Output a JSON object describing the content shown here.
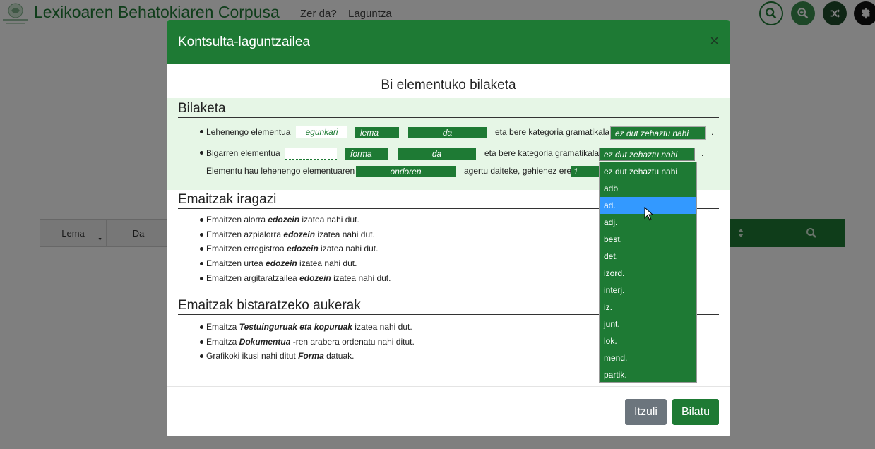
{
  "app": {
    "title": "Lexikoaren Behatokiaren Corpusa",
    "nav": [
      "Zer da?",
      "Laguntza"
    ],
    "accent_color": "#1e7a34",
    "buttons": [
      "search-icon",
      "zoom-icon",
      "shuffle-icon",
      "signpost-icon"
    ]
  },
  "background_table": {
    "cells": [
      "Lema",
      "Da"
    ],
    "right_icons": [
      "sort-icon",
      "search-icon"
    ]
  },
  "modal": {
    "title": "Kontsulta-laguntzailea",
    "close_label": "×",
    "subtitle": "Bi elementuko bilaketa",
    "search": {
      "heading": "Bilaketa",
      "first": {
        "label": "Lehenengo elementua",
        "input_placeholder": "egunkari",
        "type": "lema",
        "condition": "da",
        "category_text": "eta bere kategoria gramatikala",
        "category_value": "ez dut zehaztu nahi",
        "end": "."
      },
      "second": {
        "label": "Bigarren elementua",
        "input_value": "",
        "type": "forma",
        "condition": "da",
        "category_text": "eta bere kategoria gramatikala",
        "category_value": "ez dut zehaztu nahi",
        "end": "."
      },
      "relation": {
        "label": "Elementu hau lehenengo elementuaren",
        "value": "ondoren",
        "after_text": "agertu daiteke, gehienez ere",
        "count": "1"
      }
    },
    "filters": {
      "heading": "Emaitzak iragazi",
      "items": [
        {
          "before": "Emaitzen alorra ",
          "bold": "edozein",
          "after": " izatea nahi dut."
        },
        {
          "before": "Emaitzen azpialorra ",
          "bold": "edozein",
          "after": " izatea nahi dut."
        },
        {
          "before": "Emaitzen erregistroa ",
          "bold": "edozein",
          "after": " izatea nahi dut."
        },
        {
          "before": "Emaitzen urtea ",
          "bold": "edozein",
          "after": " izatea nahi dut."
        },
        {
          "before": "Emaitzen argitaratzailea ",
          "bold": "edozein",
          "after": " izatea nahi dut."
        }
      ]
    },
    "display": {
      "heading": "Emaitzak bistaratzeko aukerak",
      "items": [
        {
          "before": "Emaitza ",
          "bold": "Testuinguruak eta kopuruak",
          "after": " izatea nahi dut."
        },
        {
          "before": "Emaitza ",
          "bold": "Dokumentua",
          "after": " -ren arabera ordenatu nahi ditut."
        },
        {
          "before": "Grafikoki ikusi nahi ditut ",
          "bold": "Forma",
          "after": " datuak."
        }
      ]
    },
    "dropdown_options": [
      "ez dut zehaztu nahi",
      "adb",
      "ad.",
      "adj.",
      "best.",
      "det.",
      "izord.",
      "interj.",
      "iz.",
      "junt.",
      "lok.",
      "mend.",
      "partik."
    ],
    "dropdown_selected": "ad.",
    "buttons": {
      "back": "Itzuli",
      "search": "Bilatu"
    }
  }
}
